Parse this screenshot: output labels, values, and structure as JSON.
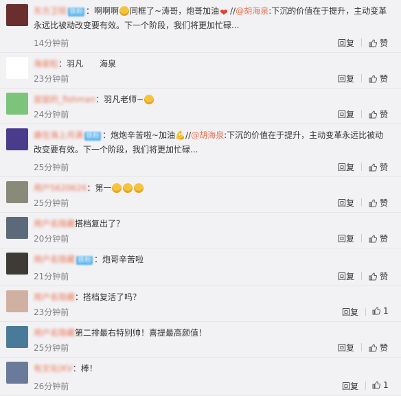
{
  "comments": [
    {
      "name": "东方卫视",
      "badge": "铁粉",
      "text_parts": [
        {
          "t": "：啊啊啊"
        },
        {
          "emoji": "yellow"
        },
        {
          "t": "同框了~涛哥，炮哥加油"
        },
        {
          "emoji": "heart"
        },
        {
          "t": "//"
        },
        {
          "mention": "@胡海泉"
        },
        {
          "t": ":下沉的价值在于提升，主动变革永远比被动改变要有效。下一个阶段，我们将更加忙碌..."
        }
      ],
      "time": "14分钟前",
      "reply_label": "回复",
      "like_label": "赞",
      "avatar_color": "#6b2e2e"
    },
    {
      "name": "海泉粒",
      "badge": "",
      "text_parts": [
        {
          "t": "：羽凡　　海泉"
        }
      ],
      "time": "23分钟前",
      "reply_label": "回复",
      "like_label": "赞",
      "avatar_color": "#ffffff"
    },
    {
      "name": "鼠鼠的_fishman",
      "badge": "",
      "text_parts": [
        {
          "t": "：羽凡老师~"
        },
        {
          "emoji": "yellow"
        }
      ],
      "time": "24分钟前",
      "reply_label": "回复",
      "like_label": "赞",
      "avatar_color": "#7cc47a"
    },
    {
      "name": "康在海上月满",
      "badge": "铁粉",
      "text_parts": [
        {
          "t": "：炮炮辛苦啦~加油"
        },
        {
          "t": "💪"
        },
        {
          "t": "//"
        },
        {
          "mention": "@胡海泉"
        },
        {
          "t": ":下沉的价值在于提升，主动变革永远比被动改变要有效。下一个阶段，我们将更加忙碌..."
        }
      ],
      "time": "25分钟前",
      "reply_label": "回复",
      "like_label": "赞",
      "avatar_color": "#4a3b8c"
    },
    {
      "name": "用户5620626",
      "badge": "",
      "text_parts": [
        {
          "t": "：第一"
        },
        {
          "emoji": "yellow"
        },
        {
          "emoji": "yellow"
        },
        {
          "emoji": "yellow"
        }
      ],
      "time": "25分钟前",
      "reply_label": "回复",
      "like_label": "赞",
      "avatar_color": "#8a8a7a"
    },
    {
      "name": "用户名隐藏",
      "badge": "",
      "text_parts": [
        {
          "t": "搭档复出了？"
        }
      ],
      "time": "20分钟前",
      "reply_label": "回复",
      "like_label": "赞",
      "avatar_color": "#5a6a7a"
    },
    {
      "name": "用户名隐藏",
      "badge": "铁粉",
      "text_parts": [
        {
          "t": "：炮哥辛苦啦"
        }
      ],
      "time": "21分钟前",
      "reply_label": "回复",
      "like_label": "赞",
      "avatar_color": "#3e3a34"
    },
    {
      "name": "用户名隐藏",
      "badge": "",
      "text_parts": [
        {
          "t": "：搭档复活了吗？"
        }
      ],
      "time": "23分钟前",
      "reply_label": "回复",
      "like_label": "1",
      "avatar_color": "#d0b0a0"
    },
    {
      "name": "用户名隐藏",
      "badge": "",
      "text_parts": [
        {
          "t": "第二排最右特别帅！喜提最高颜值！"
        }
      ],
      "time": "25分钟前",
      "reply_label": "回复",
      "like_label": "赞",
      "avatar_color": "#4a7a9a"
    },
    {
      "name": "有文化(KV",
      "badge": "",
      "text_parts": [
        {
          "t": "：棒！"
        }
      ],
      "time": "26分钟前",
      "reply_label": "回复",
      "like_label": "1",
      "avatar_color": "#6a7a9a"
    }
  ]
}
